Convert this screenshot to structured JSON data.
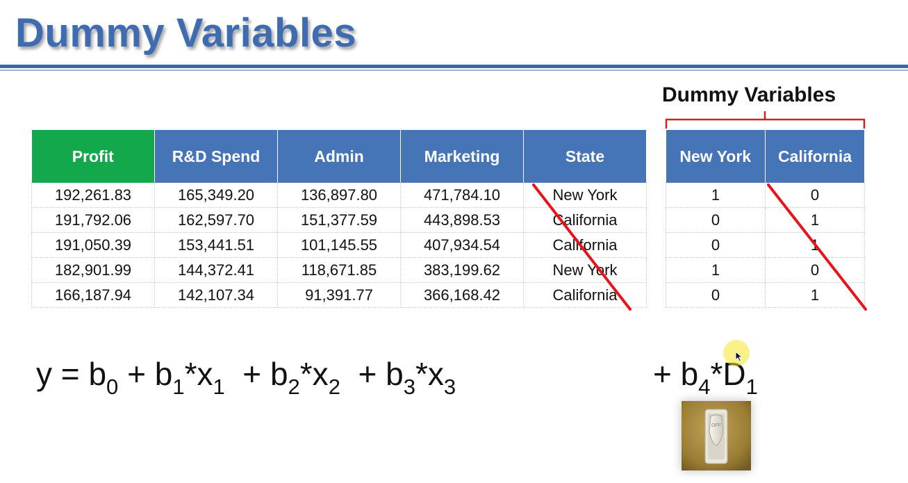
{
  "title": "Dummy Variables",
  "dummy_label": "Dummy Variables",
  "table": {
    "headers": [
      "Profit",
      "R&D Spend",
      "Admin",
      "Marketing",
      "State"
    ],
    "rows": [
      [
        "192,261.83",
        "165,349.20",
        "136,897.80",
        "471,784.10",
        "New York"
      ],
      [
        "191,792.06",
        "162,597.70",
        "151,377.59",
        "443,898.53",
        "California"
      ],
      [
        "191,050.39",
        "153,441.51",
        "101,145.55",
        "407,934.54",
        "California"
      ],
      [
        "182,901.99",
        "144,372.41",
        "118,671.85",
        "383,199.62",
        "New York"
      ],
      [
        "166,187.94",
        "142,107.34",
        "91,391.77",
        "366,168.42",
        "California"
      ]
    ]
  },
  "dummy_table": {
    "headers": [
      "New York",
      "California"
    ],
    "rows": [
      [
        "1",
        "0"
      ],
      [
        "0",
        "1"
      ],
      [
        "0",
        "1"
      ],
      [
        "1",
        "0"
      ],
      [
        "0",
        "1"
      ]
    ]
  },
  "equation": {
    "y": "y",
    "eq": "=",
    "b0": "b",
    "b0_sub": "0",
    "plus1": "+",
    "b1": "b",
    "b1_sub": "1",
    "x1": "*x",
    "x1_sub": "1",
    "plus2": "+",
    "b2": "b",
    "b2_sub": "2",
    "x2": "*x",
    "x2_sub": "2",
    "plus3": "+",
    "b3": "b",
    "b3_sub": "3",
    "x3": "*x",
    "x3_sub": "3",
    "plus4": "+",
    "b4": "b",
    "b4_sub": "4",
    "d1": "*D",
    "d1_sub": "1"
  },
  "switch": {
    "label": "OFF",
    "icon": "light-switch-icon"
  },
  "colors": {
    "title": "#3f6cb0",
    "header_blue": "#4575b7",
    "header_green": "#14a84c",
    "strike_red": "#e8141c",
    "bracket_red": "#d42020"
  }
}
